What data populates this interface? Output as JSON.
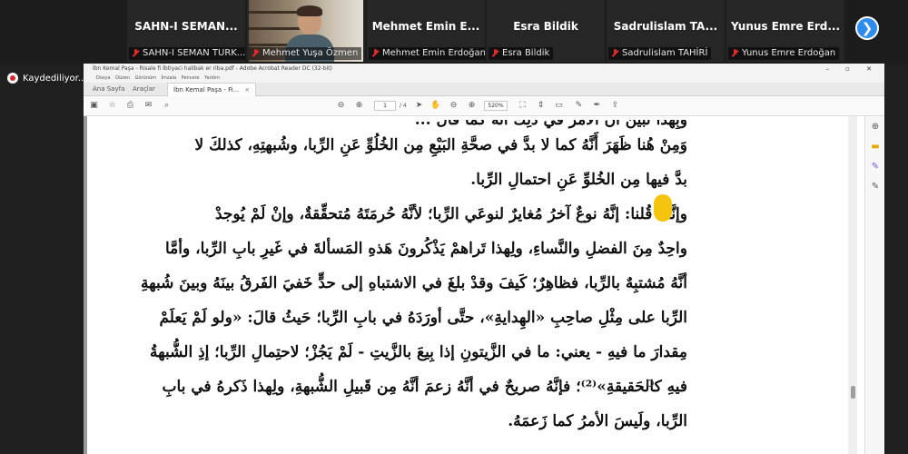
{
  "participants": [
    {
      "display_name": "SAHN-I SEMAN...",
      "label": "SAHN-I SEMAN TURK..."
    },
    {
      "display_name": "",
      "label": "Mehmet Yuşa Özmen"
    },
    {
      "display_name": "Mehmet Emin E...",
      "label": "Mehmet Emin Erdoğan"
    },
    {
      "display_name": "Esra Bildik",
      "label": "Esra Bildik"
    },
    {
      "display_name": "Sadrulislam TA...",
      "label": "Sadrulislam TAHİRİ"
    },
    {
      "display_name": "Yunus Emre Erd...",
      "label": "Yunus Emre Erdoğan"
    }
  ],
  "next_button_glyph": "❯",
  "recording": {
    "label": "Kaydediliyor...",
    "pause_glyph": "❚❚",
    "stop_glyph": "■"
  },
  "acrobat": {
    "title": "İbn Kemal Paşa - Risale fi İbtiyaci halibak er riba.pdf - Adobe Acrobat Reader DC (32-bit)",
    "window_buttons": "– ▫ ✕",
    "menu": "Dosya  Düzen  Görünüm  İmzala  Pencere  Yardım",
    "tabs": [
      {
        "label": "Ana Sayfa"
      },
      {
        "label": "Araçlar"
      },
      {
        "label": "İbn Kemal Paşa - Fi..."
      }
    ],
    "tab_close": "×",
    "page_current": "1",
    "page_total": "/ 4",
    "zoom": "520%",
    "toolbar_icons": [
      "save-icon",
      "bookmark-icon",
      "print-icon",
      "email-icon",
      "search-icon",
      "prev-page-icon",
      "next-page-icon",
      "select-icon",
      "hand-icon",
      "zoom-out-icon",
      "zoom-in-icon",
      "fit-icon",
      "scroll-icon",
      "comment-icon",
      "pen-icon",
      "sign-icon",
      "share-icon"
    ],
    "side_icons": [
      "zoom-icon",
      "comment-icon",
      "edit-icon",
      "tools-icon"
    ]
  },
  "document_lines": [
    "وَمِنْ هُنا ظَهَرَ أَنَّهُ كما لا بدَّ في صحَّةِ البَيْعِ مِن الخُلُوِّ عَنِ الرِّبا، وشُبهتِهِ، كذلكَ لا",
    "بدَّ فيها مِن الخُلوِّ عَنِ احتمالِ الرِّبا.",
    "وإنَّما قُلنا: إنَّهُ نوعٌ آخرُ مُغايرٌ لنوعَي الرِّبا؛ لأنَّهُ حُرمَتَهُ مُتحقِّقةٌ، وإنْ لَمْ يُوجدْ",
    "واحِدٌ مِنَ الفضلِ والنَّساءِ، ولِهذا تَراهمْ يَذْكُرونَ هَذهِ المَسألةَ في غَيرِ بابِ الرِّبا، وأمَّا",
    "أنَّهُ مُشتبِهٌ بالرِّبا، فظاهِرٌ؛ كَيفَ وقدْ بلغَ في الاشتباهِ إلى حدٍّ خَفيَ الفَرقُ بينَهُ وبينَ شُبهةِ",
    "الرِّبا على مِثْلِ صاحِبِ «الهِدايةِ»، حتَّى أورَدَهُ في بابِ الرِّبا؛ حَيثُ قالَ: «ولو لَمْ يَعلَمْ",
    "مِقدارَ ما فيهِ - يعني: ما في الزَّيتونِ إذا بِيعَ بالزَّيتِ - لَمْ يَجُزْ؛ لاحتِمالِ الرِّبا؛ إذِ الشُّبهةُ",
    "فيهِ كالحَقيقةِ»⁽²⁾؛ فإنَّهُ صريحٌ في أنَّهُ زعمَ أنَّهُ مِن قَبيلِ الشُّبهةِ، ولِهذا ذَكرهُ في بابِ",
    "الرِّبا، ولَيسَ الأمرُ كما زَعمَهُ."
  ]
}
